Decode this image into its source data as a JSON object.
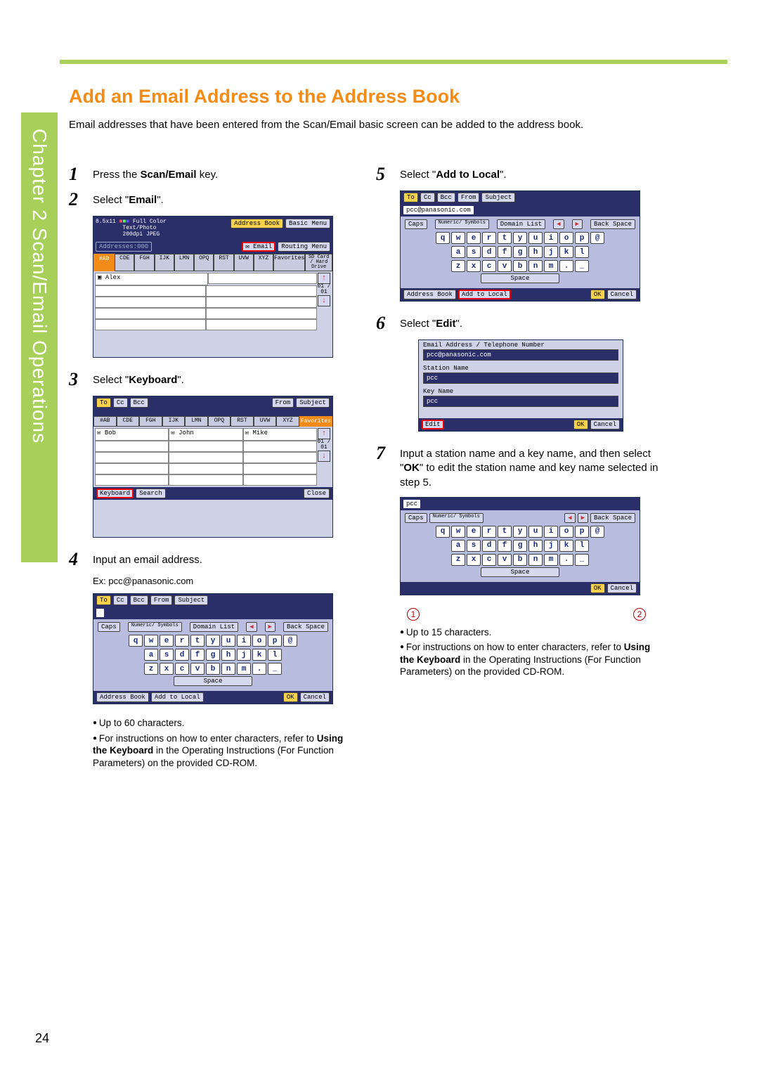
{
  "page": {
    "number": "24",
    "chapter_tab": "Chapter 2   Scan/Email Operations",
    "title": "Add an Email Address to the Address Book",
    "intro": "Email addresses that have been entered from the Scan/Email basic screen can be added to the address book."
  },
  "steps": {
    "s1": {
      "num": "1",
      "text_a": "Press the ",
      "text_bold": "Scan/Email",
      "text_b": " key."
    },
    "s2": {
      "num": "2",
      "text_a": "Select \"",
      "text_bold": "Email",
      "text_b": "\"."
    },
    "s3": {
      "num": "3",
      "text_a": "Select \"",
      "text_bold": "Keyboard",
      "text_b": "\"."
    },
    "s4": {
      "num": "4",
      "text_a": "Input an email address."
    },
    "s4_ex": "Ex: pcc@panasonic.com",
    "s4_notes": {
      "a": "Up to 60 characters.",
      "b_pre": "For instructions on how to enter characters, refer to ",
      "b_bold": "Using the Keyboard",
      "b_post": " in the Operating Instructions (For Function Parameters) on the provided CD-ROM."
    },
    "s5": {
      "num": "5",
      "text_a": "Select \"",
      "text_bold": "Add to Local",
      "text_b": "\"."
    },
    "s6": {
      "num": "6",
      "text_a": "Select \"",
      "text_bold": "Edit",
      "text_b": "\"."
    },
    "s7": {
      "num": "7",
      "text_a": "Input a station name and a key name, and then select \"",
      "text_bold": "OK",
      "text_b": "\" to edit the station name and key name selected in step 5."
    },
    "s7_notes": {
      "a": "Up to 15 characters.",
      "b_pre": "For instructions on how to enter characters, refer to ",
      "b_bold": "Using the Keyboard",
      "b_post": " in the Operating Instructions (For Function Parameters) on the provided CD-ROM."
    }
  },
  "fig2": {
    "header": {
      "size": "8.5x11",
      "mode1": "Full Color",
      "mode2": "Text/Photo",
      "mode3": "200dpi JPEG",
      "addresses": "Addresses:000"
    },
    "btn_address_book": "Address Book",
    "btn_basic_menu": "Basic Menu",
    "btn_email": "Email",
    "btn_routing": "Routing Menu",
    "tabs": [
      "#AB",
      "CDE",
      "FGH",
      "IJK",
      "LMN",
      "OPQ",
      "RST",
      "UVW",
      "XYZ",
      "Favorites"
    ],
    "btn_sdcard": "SD Card / Hard Drive",
    "row1_name": "Alex",
    "counter": "01 / 01"
  },
  "fig3": {
    "tabs_top": [
      "To",
      "Cc",
      "Bcc",
      "From",
      "Subject"
    ],
    "tabs_alpha": [
      "#AB",
      "CDE",
      "FGH",
      "IJK",
      "LMN",
      "OPQ",
      "RST",
      "UVW",
      "XYZ",
      "Favorites"
    ],
    "names": [
      "Bob",
      "John",
      "Mike"
    ],
    "counter": "01 / 01",
    "btn_keyboard": "Keyboard",
    "btn_search": "Search",
    "btn_close": "Close"
  },
  "kbd": {
    "tabs_top": [
      "To",
      "Cc",
      "Bcc",
      "From",
      "Subject"
    ],
    "value": "pcc@panasonic.com",
    "btn_caps": "Caps",
    "btn_numsym": "Numeric/ Symbols",
    "btn_domain": "Domain List",
    "btn_backspace": "Back Space",
    "btn_space": "Space",
    "row1": [
      "q",
      "w",
      "e",
      "r",
      "t",
      "y",
      "u",
      "i",
      "o",
      "p",
      "@"
    ],
    "row2": [
      "a",
      "s",
      "d",
      "f",
      "g",
      "h",
      "j",
      "k",
      "l"
    ],
    "row3": [
      "z",
      "x",
      "c",
      "v",
      "b",
      "n",
      "m",
      ".",
      "_"
    ],
    "btn_address_book": "Address Book",
    "btn_add_local": "Add to Local",
    "btn_ok": "OK",
    "btn_cancel": "Cancel"
  },
  "fig6": {
    "header": "Email Address / Telephone Number",
    "email": "pcc@panasonic.com",
    "station_lbl": "Station Name",
    "station_val": "pcc",
    "key_lbl": "Key Name",
    "key_val": "pcc",
    "btn_edit": "Edit",
    "btn_ok": "OK",
    "btn_cancel": "Cancel"
  },
  "fig7": {
    "value": "pcc",
    "callout1": "1",
    "callout2": "2"
  }
}
